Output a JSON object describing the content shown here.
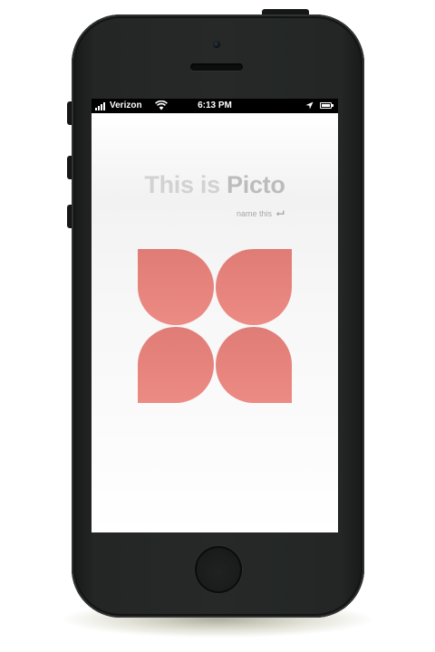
{
  "status_bar": {
    "carrier": "Verizon",
    "time": "6:13 PM",
    "signal_bars": 4,
    "icons": [
      "signal-icon",
      "wifi-icon",
      "location-arrow-icon",
      "battery-icon"
    ]
  },
  "screen": {
    "headline_prefix": "This is ",
    "headline_brand": "Picto",
    "action_label": "name this",
    "action_icon": "return-arrow-icon",
    "logo_icon": "picto-petal-logo"
  },
  "colors": {
    "logo_top": "#e07c76",
    "logo_bottom": "#ec8a84",
    "headline_prefix": "#d2d2d2",
    "headline_brand": "#bcbcbc",
    "action_text": "#a8a8a8",
    "device_body": "#232625"
  }
}
